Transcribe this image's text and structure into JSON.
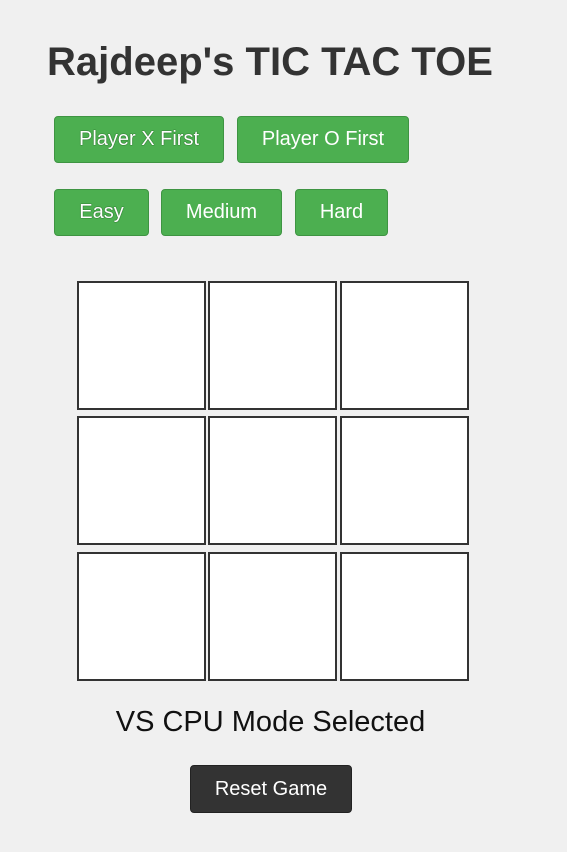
{
  "title": "Rajdeep's TIC TAC TOE",
  "first_player_buttons": {
    "x_first": "Player X First",
    "o_first": "Player O First"
  },
  "difficulty_buttons": {
    "easy": "Easy",
    "medium": "Medium",
    "hard": "Hard"
  },
  "board": {
    "cells": [
      "",
      "",
      "",
      "",
      "",
      "",
      "",
      "",
      ""
    ]
  },
  "status": "VS CPU Mode Selected",
  "reset_label": "Reset Game",
  "colors": {
    "background": "#f0f0f0",
    "button_green": "#4caf50",
    "reset_dark": "#333333",
    "cell_border": "#333333",
    "cell_fill": "#ffffff"
  }
}
